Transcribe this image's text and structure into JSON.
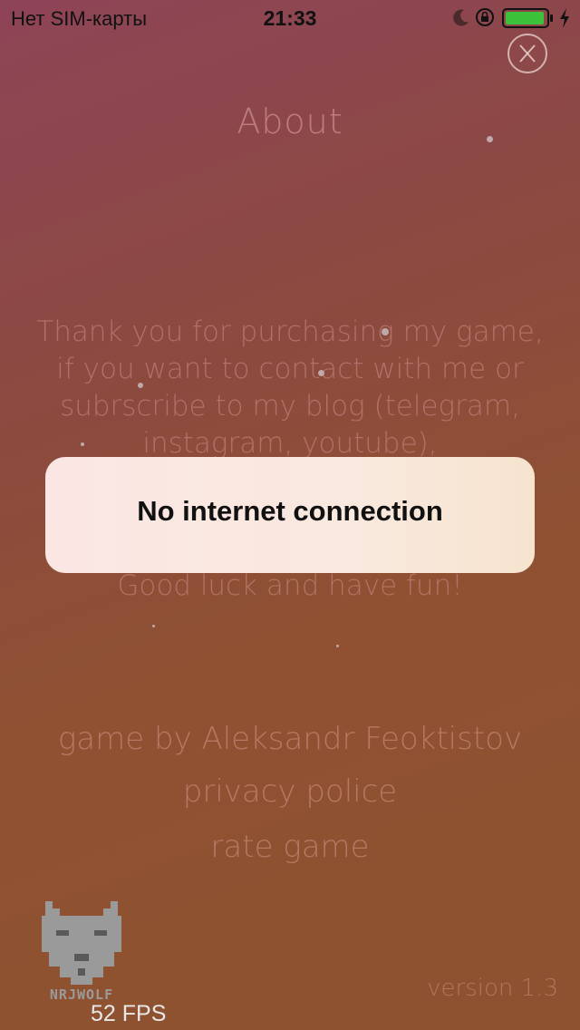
{
  "status_bar": {
    "carrier": "Нет SIM-карты",
    "time": "21:33",
    "icons": [
      "moon-icon",
      "orientation-lock-icon",
      "battery-icon",
      "charging-icon"
    ],
    "battery_level": 0.95,
    "battery_color": "#3cc13b"
  },
  "screen": {
    "title": "About",
    "body_lines": [
      "Thank you for purchasing my game,",
      "if you want to contact with me or",
      "subrscribe to my blog (telegram,",
      "instagram, youtube),"
    ],
    "closing": "Good luck and have fun!",
    "author_link": "game by Aleksandr Feoktistov",
    "privacy_link": "privacy police",
    "rate_link": "rate game",
    "version": "version 1.3",
    "fps": "52 FPS",
    "logo_text": "NRJWOLF"
  },
  "toast": {
    "message": "No internet connection"
  },
  "colors": {
    "bg_top": "#8e4457",
    "bg_bottom": "#8e5230",
    "toast_bg": "#f9e8df"
  }
}
